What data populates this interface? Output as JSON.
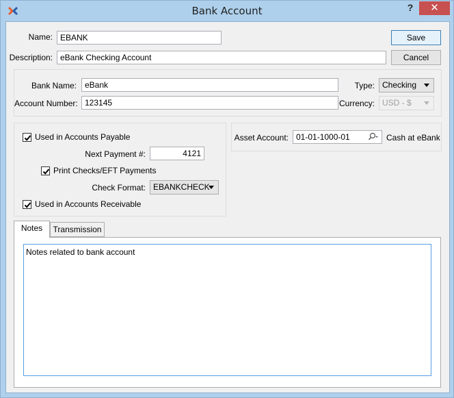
{
  "window": {
    "title": "Bank Account",
    "help_label": "?",
    "close_label": "✕",
    "app_icon": "xtuple-x-icon"
  },
  "form": {
    "name_label": "Name:",
    "name_value": "EBANK",
    "description_label": "Description:",
    "description_value": "eBank Checking Account",
    "save_label": "Save",
    "cancel_label": "Cancel"
  },
  "bank": {
    "bank_name_label": "Bank Name:",
    "bank_name_value": "eBank",
    "account_number_label": "Account Number:",
    "account_number_value": "123145",
    "type_label": "Type:",
    "type_value": "Checking",
    "currency_label": "Currency:",
    "currency_value": "USD - $"
  },
  "payables": {
    "used_in_ap_label": "Used in Accounts Payable",
    "used_in_ap_checked": true,
    "next_payment_label": "Next Payment #:",
    "next_payment_value": "4121",
    "print_checks_label": "Print Checks/EFT Payments",
    "print_checks_checked": true,
    "check_format_label": "Check Format:",
    "check_format_value": "EBANKCHECK",
    "used_in_ar_label": "Used in Accounts Receivable",
    "used_in_ar_checked": true
  },
  "asset": {
    "label": "Asset Account:",
    "value": "01-01-1000-01",
    "description": "Cash at eBank",
    "search_icon": "search-dropdown-icon"
  },
  "tabs": [
    {
      "label": "Notes",
      "active": true
    },
    {
      "label": "Transmission",
      "active": false
    }
  ],
  "notes": {
    "value": "Notes related to bank account"
  }
}
